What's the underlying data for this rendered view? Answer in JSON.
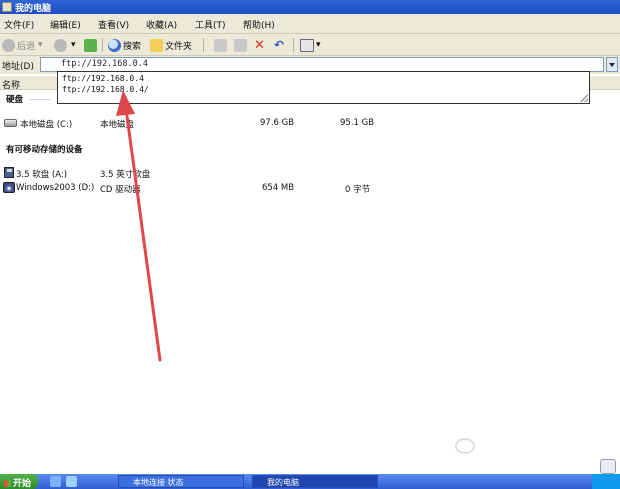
{
  "window": {
    "title": "我的电脑"
  },
  "menu": [
    "文件(F)",
    "编辑(E)",
    "查看(V)",
    "收藏(A)",
    "工具(T)",
    "帮助(H)"
  ],
  "toolbar": {
    "back_label": "后退",
    "search_label": "搜索",
    "folders_label": "文件夹"
  },
  "address": {
    "label": "地址(D)",
    "value": "ftp://192.168.0.4",
    "suggestions": [
      "ftp://192.168.0.4",
      "ftp://192.168.0.4/"
    ]
  },
  "columns": {
    "name": "名称"
  },
  "groups": {
    "hard_disks": "硬盘",
    "removable": "有可移动存储的设备"
  },
  "drives": [
    {
      "name": "本地磁盘 (C:)",
      "type": "本地磁盘",
      "total": "97.6 GB",
      "free": "95.1 GB"
    }
  ],
  "removable_devices": [
    {
      "name": "3.5 软盘 (A:)",
      "type": "3.5 英寸软盘",
      "total": "",
      "free": ""
    },
    {
      "name": "Windows2003 (D:)",
      "type": "CD 驱动器",
      "total": "654 MB",
      "free": "0 字节"
    }
  ],
  "annotation": {
    "color": "#e0474a"
  },
  "taskbar": {
    "start_label": "开始",
    "tasks": [
      "本地连接 状态",
      "我的电脑"
    ]
  }
}
